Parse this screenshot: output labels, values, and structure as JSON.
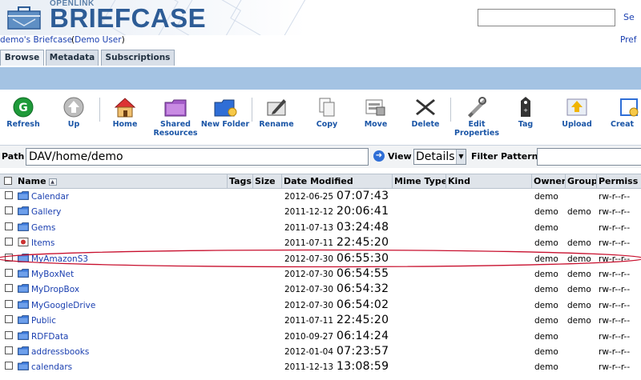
{
  "app": {
    "logo_small": "OPENLINK",
    "logo_big": "BRIEFCASE",
    "search_button": "Se",
    "owner_link": "demo's Briefcase",
    "user_paren_open": "(",
    "user_link": "Demo User",
    "user_paren_close": ")",
    "prefs_link": "Pref"
  },
  "tabs": [
    {
      "label": "Browse",
      "active": true
    },
    {
      "label": "Metadata",
      "active": false
    },
    {
      "label": "Subscriptions",
      "active": false
    }
  ],
  "toolbar": [
    {
      "label": "Refresh",
      "icon": "refresh-icon"
    },
    {
      "label": "Up",
      "icon": "up-arrow-icon"
    },
    {
      "label": "Home",
      "icon": "home-icon"
    },
    {
      "label": "Shared\nResources",
      "icon": "shared-folder-icon"
    },
    {
      "label": "New Folder",
      "icon": "new-folder-icon"
    },
    {
      "label": "Rename",
      "icon": "rename-icon"
    },
    {
      "label": "Copy",
      "icon": "copy-icon"
    },
    {
      "label": "Move",
      "icon": "move-icon"
    },
    {
      "label": "Delete",
      "icon": "delete-icon"
    },
    {
      "label": "Edit\nProperties",
      "icon": "edit-properties-icon"
    },
    {
      "label": "Tag",
      "icon": "tag-icon"
    },
    {
      "label": "Upload",
      "icon": "upload-icon"
    },
    {
      "label": "Creat",
      "icon": "create-icon"
    }
  ],
  "pathbar": {
    "path_label": "Path",
    "path_value": "DAV/home/demo",
    "view_label": "View",
    "view_value": "Details",
    "filter_label": "Filter Pattern",
    "filter_value": ""
  },
  "table": {
    "columns": {
      "name": "Name",
      "tags": "Tags",
      "size": "Size",
      "date": "Date Modified",
      "mime": "Mime Type",
      "kind": "Kind",
      "owner": "Owner",
      "group": "Group",
      "perms": "Permiss"
    },
    "rows": [
      {
        "name": "Calendar",
        "date": "2012-06-25",
        "time": "07:07:43",
        "owner": "demo",
        "group": "",
        "perms": "rw-r--r--",
        "icon": "folder-icon"
      },
      {
        "name": "Gallery",
        "date": "2011-12-12",
        "time": "20:06:41",
        "owner": "demo",
        "group": "demo",
        "perms": "rw-r--r--",
        "icon": "folder-icon"
      },
      {
        "name": "Gems",
        "date": "2011-07-13",
        "time": "03:24:48",
        "owner": "demo",
        "group": "",
        "perms": "rw-r--r--",
        "icon": "folder-icon"
      },
      {
        "name": "Items",
        "date": "2011-07-11",
        "time": "22:45:20",
        "owner": "demo",
        "group": "demo",
        "perms": "rw-r--r--",
        "icon": "special-folder-icon"
      },
      {
        "name": "MyAmazonS3",
        "date": "2012-07-30",
        "time": "06:55:30",
        "owner": "demo",
        "group": "demo",
        "perms": "rw-r--r--",
        "icon": "folder-icon"
      },
      {
        "name": "MyBoxNet",
        "date": "2012-07-30",
        "time": "06:54:55",
        "owner": "demo",
        "group": "demo",
        "perms": "rw-r--r--",
        "icon": "folder-icon"
      },
      {
        "name": "MyDropBox",
        "date": "2012-07-30",
        "time": "06:54:32",
        "owner": "demo",
        "group": "demo",
        "perms": "rw-r--r--",
        "icon": "folder-icon"
      },
      {
        "name": "MyGoogleDrive",
        "date": "2012-07-30",
        "time": "06:54:02",
        "owner": "demo",
        "group": "demo",
        "perms": "rw-r--r--",
        "icon": "folder-icon"
      },
      {
        "name": "Public",
        "date": "2011-07-11",
        "time": "22:45:20",
        "owner": "demo",
        "group": "demo",
        "perms": "rw-r--r--",
        "icon": "folder-icon"
      },
      {
        "name": "RDFData",
        "date": "2010-09-27",
        "time": "06:14:24",
        "owner": "demo",
        "group": "",
        "perms": "rw-r--r--",
        "icon": "folder-icon"
      },
      {
        "name": "addressbooks",
        "date": "2012-01-04",
        "time": "07:23:57",
        "owner": "demo",
        "group": "",
        "perms": "rw-r--r--",
        "icon": "folder-icon"
      },
      {
        "name": "calendars",
        "date": "2011-12-13",
        "time": "13:08:59",
        "owner": "demo",
        "group": "",
        "perms": "rw-r--r--",
        "icon": "folder-icon"
      }
    ]
  },
  "colors": {
    "brand": "#2d5c96",
    "link": "#1a3fb0",
    "highlight_ring": "#c8102e"
  }
}
